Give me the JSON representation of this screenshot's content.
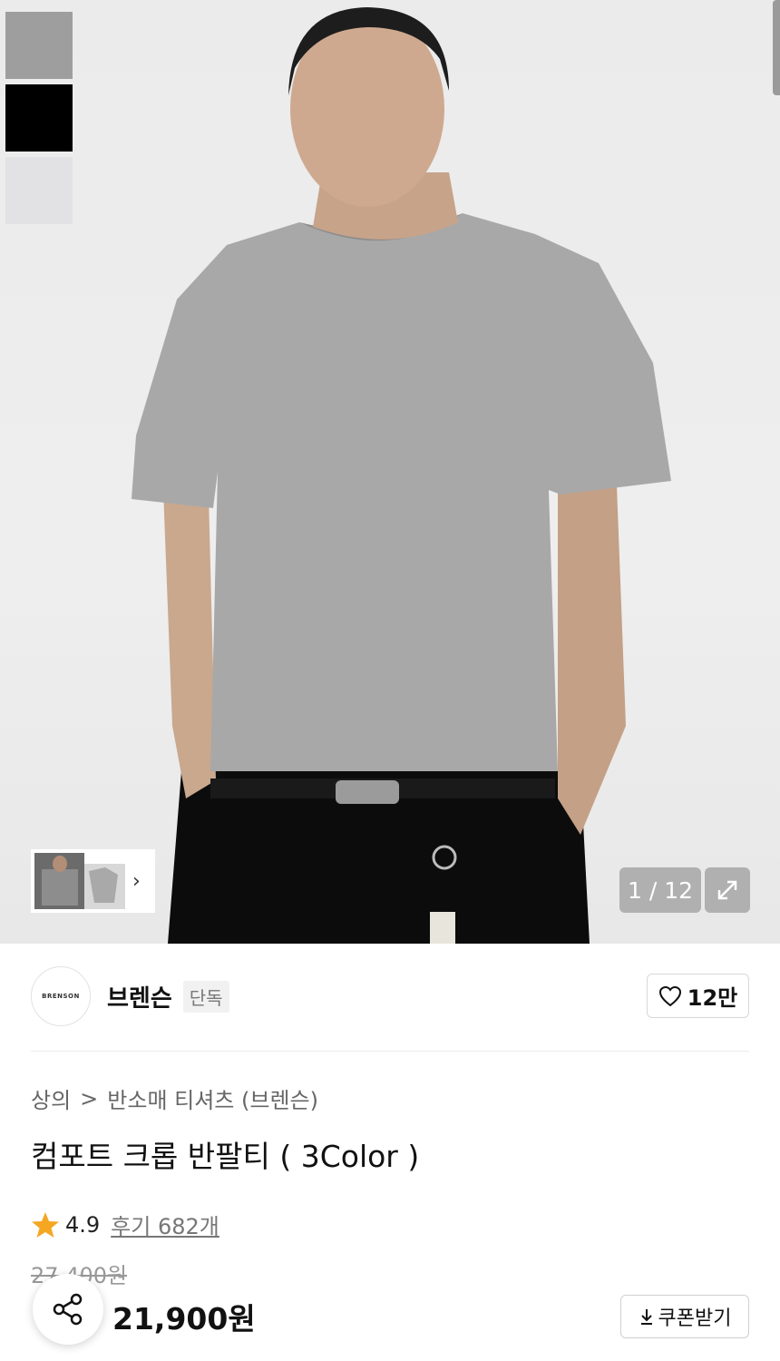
{
  "gallery": {
    "counter": "1 / 12",
    "swatch_colors": [
      "#9e9e9e",
      "#000000",
      "#e2e2e4"
    ],
    "icons": {
      "expand": "expand-icon",
      "next": "chevron-right-icon"
    }
  },
  "brand": {
    "logo_text": "BRENSON",
    "name": "브렌슨",
    "tag": "단독",
    "likes": "12만"
  },
  "breadcrumb": {
    "category": "상의",
    "separator": ">",
    "subcategory": "반소매 티셔츠 (브렌슨)"
  },
  "product": {
    "title": "컴포트 크롭 반팔티 ( 3Color )",
    "rating": "4.9",
    "reviews": "후기 682개",
    "original_price": "27,400원",
    "price": "21,900원",
    "coupon_label": "쿠폰받기"
  },
  "colors": {
    "star": "#f5a623",
    "text": "#111111",
    "muted": "#777777"
  }
}
